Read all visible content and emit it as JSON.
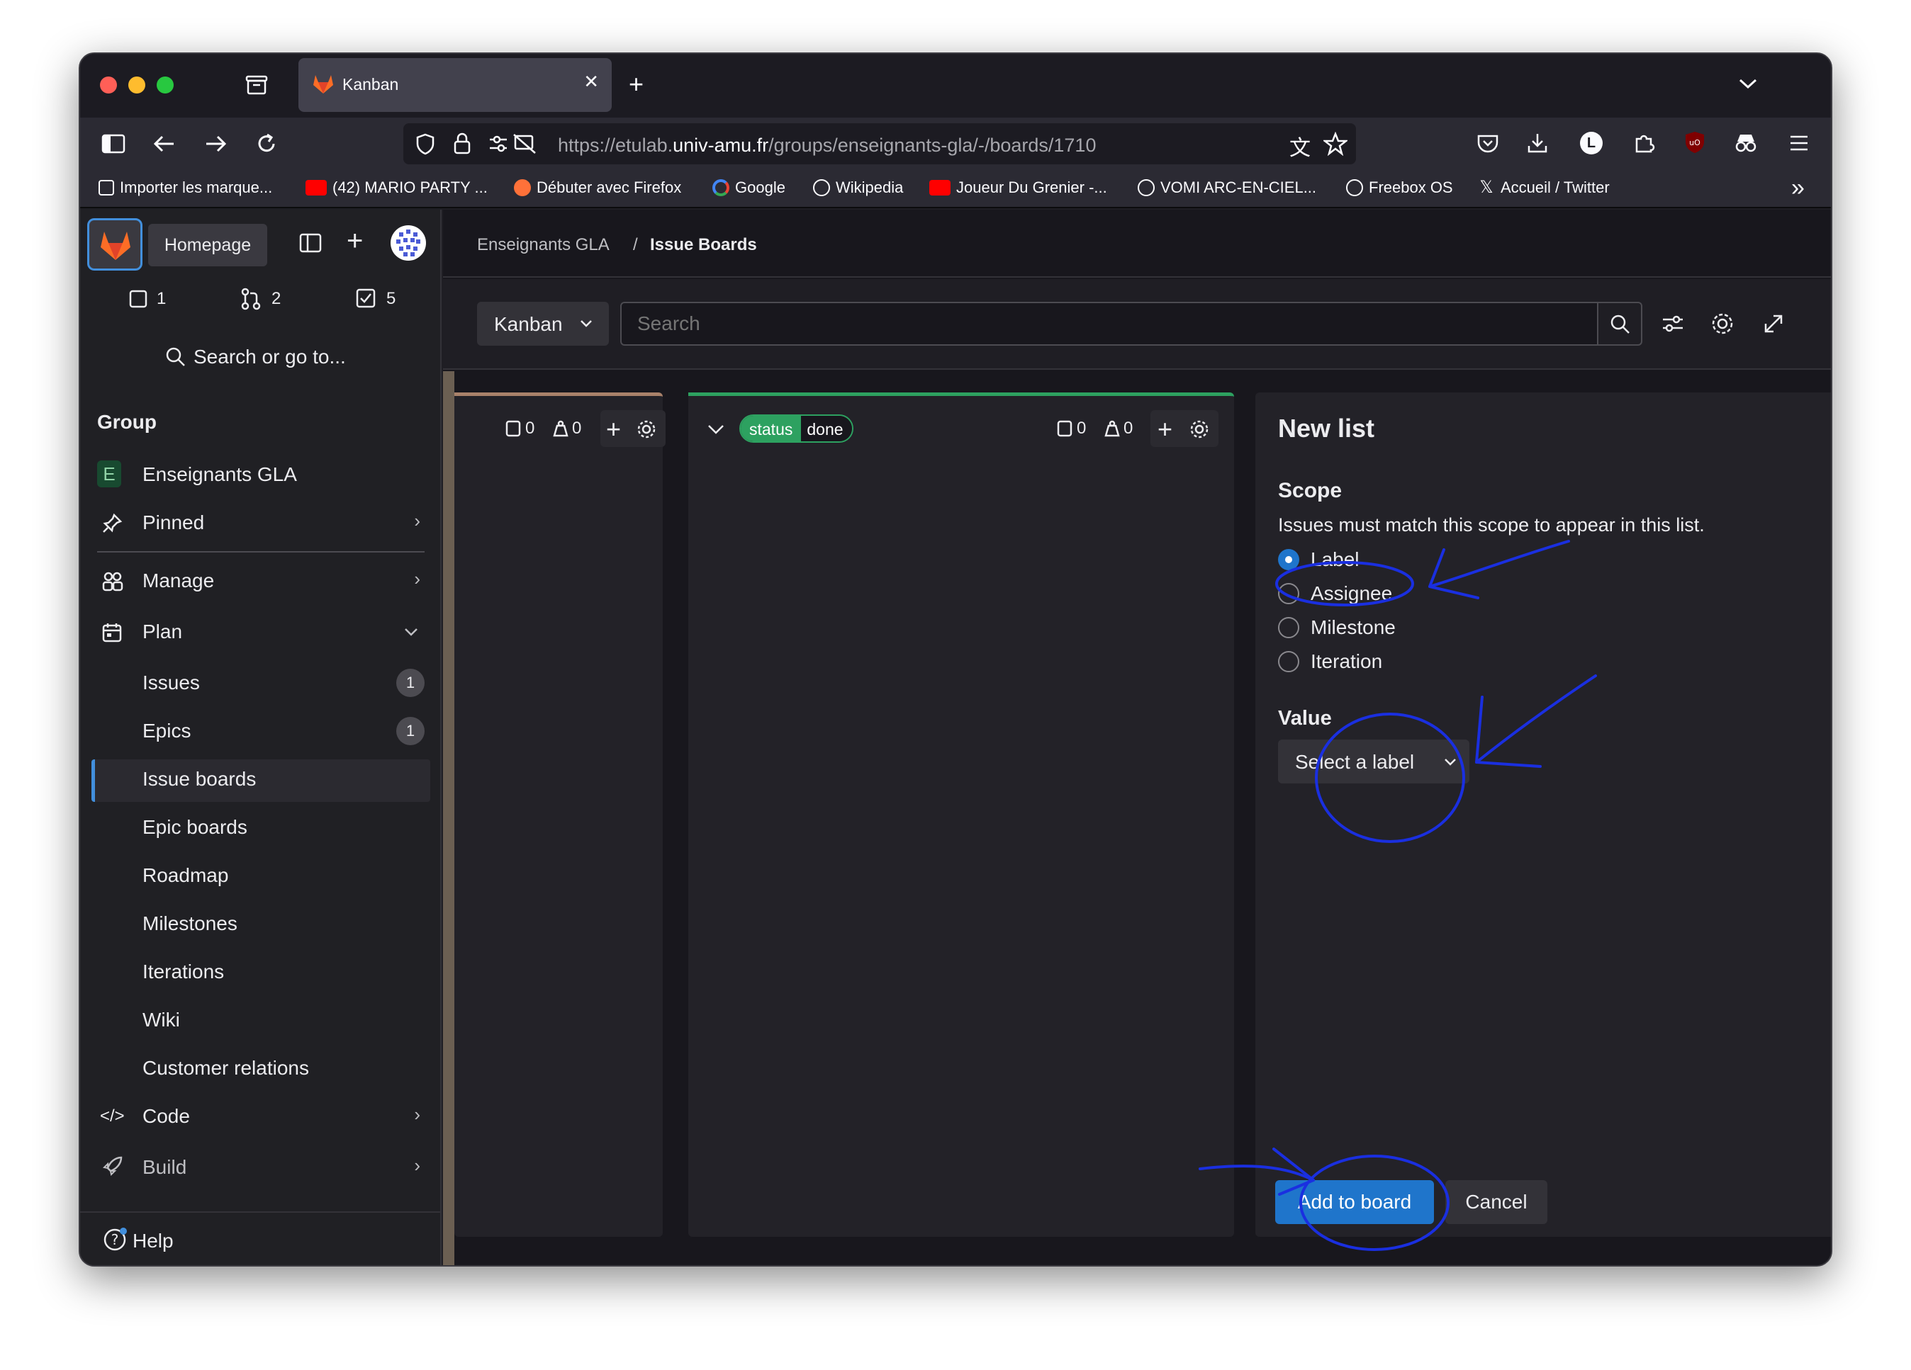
{
  "browser": {
    "tab_title": "Kanban",
    "tab_close": "✕",
    "new_tab": "+",
    "url_prefix": "https://etulab.",
    "url_domain": "univ-amu.fr",
    "url_path": "/groups/enseignants-gla/-/boards/1710",
    "profile_letter": "L",
    "bookmarks": [
      "Importer les marque...",
      "(42) MARIO PARTY ...",
      "Débuter avec Firefox",
      "Google",
      "Wikipedia",
      "Joueur Du Grenier -...",
      "VOMI ARC-EN-CIEL...",
      "Freebox OS",
      "Accueil / Twitter"
    ],
    "more_bookmarks": "»"
  },
  "sidebar": {
    "homepage_tooltip": "Homepage",
    "counters": {
      "issues": "1",
      "merge_requests": "2",
      "todos": "5"
    },
    "search": "Search or go to...",
    "group_heading": "Group",
    "group_avatar_letter": "E",
    "group_name": "Enseignants GLA",
    "pinned": "Pinned",
    "manage": "Manage",
    "plan": "Plan",
    "plan_items": [
      {
        "label": "Issues",
        "count": "1"
      },
      {
        "label": "Epics",
        "count": "1"
      },
      {
        "label": "Issue boards"
      },
      {
        "label": "Epic boards"
      },
      {
        "label": "Roadmap"
      },
      {
        "label": "Milestones"
      },
      {
        "label": "Iterations"
      },
      {
        "label": "Wiki"
      },
      {
        "label": "Customer relations"
      }
    ],
    "code": "Code",
    "build": "Build",
    "help": "Help"
  },
  "breadcrumb": {
    "group": "Enseignants GLA",
    "separator": "/",
    "page": "Issue Boards"
  },
  "filter": {
    "board_name": "Kanban",
    "search_placeholder": "Search"
  },
  "board": {
    "list1": {
      "issues": "0",
      "weight": "0"
    },
    "list2": {
      "label_scope": "status",
      "label_value": "done",
      "issues": "0",
      "weight": "0"
    }
  },
  "new_list": {
    "title": "New list",
    "scope_heading": "Scope",
    "scope_desc": "Issues must match this scope to appear in this list.",
    "options": [
      "Label",
      "Assignee",
      "Milestone",
      "Iteration"
    ],
    "selected": "Label",
    "value_heading": "Value",
    "select_placeholder": "Select a label",
    "add_button": "Add to board",
    "cancel_button": "Cancel"
  },
  "colors": {
    "accent_blue": "#1f75cb",
    "annotation_ink": "#1a2fe0",
    "status_green": "#2da160",
    "list1_border": "#a9826a"
  }
}
